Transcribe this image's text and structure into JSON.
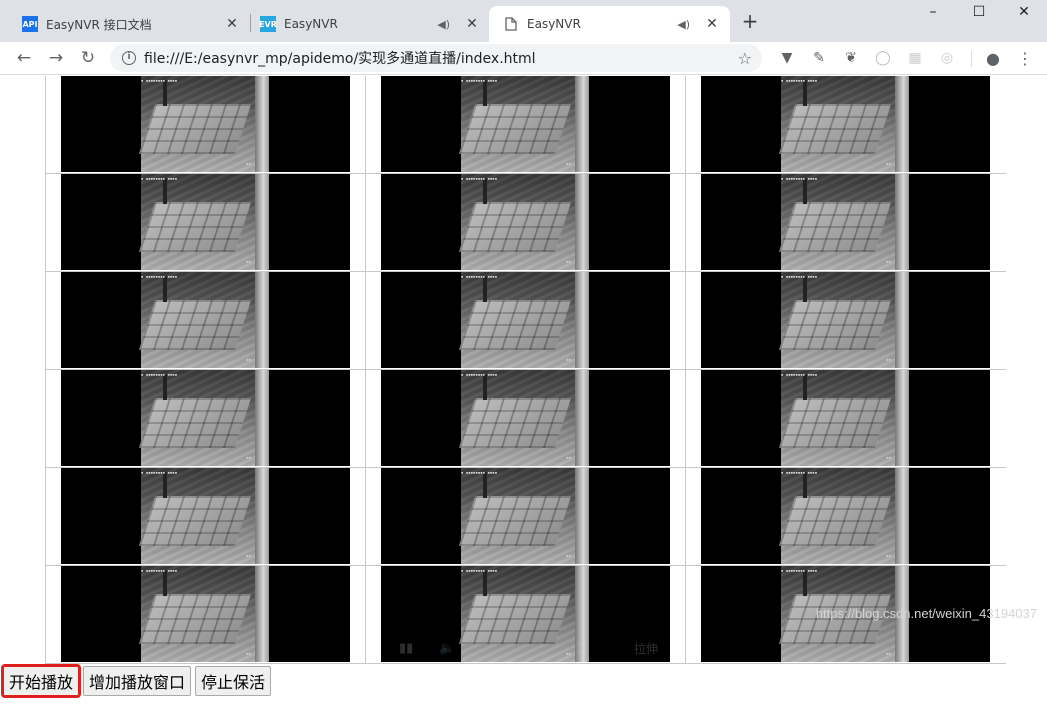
{
  "browser": {
    "tabs": [
      {
        "icon_label": "API",
        "icon_color": "#1a73e8",
        "title": "EasyNVR 接口文档",
        "audio": false,
        "active": false
      },
      {
        "icon_label": "EVR",
        "icon_color": "#29a6e0",
        "title": "EasyNVR",
        "audio": true,
        "active": false
      },
      {
        "icon_label": "",
        "icon_color": "",
        "title": "EasyNVR",
        "audio": true,
        "active": true
      }
    ],
    "new_tab_glyph": "+",
    "window": {
      "minimize": "–",
      "maximize": "☐",
      "close": "✕"
    },
    "url": "file:///E:/easynvr_mp/apidemo/实现多通道直播/index.html"
  },
  "video_grid": {
    "rows": 6,
    "cols": 3,
    "osd_text": "▪ ▪▪▪▪▪▪▪▪  ▪▪▪▪",
    "controls": {
      "play": "▮▮",
      "volume": "🔈",
      "fullscreen": "⛶",
      "stretch": "拉伸"
    },
    "controls_visible_cell": 16
  },
  "buttons": {
    "start": "开始播放",
    "add_window": "增加播放窗口",
    "stop_keepalive": "停止保活"
  },
  "watermark": "https://blog.csdn.net/weixin_43194037",
  "colors": {
    "highlight": "#e0201a",
    "video_bg": "#000000"
  }
}
